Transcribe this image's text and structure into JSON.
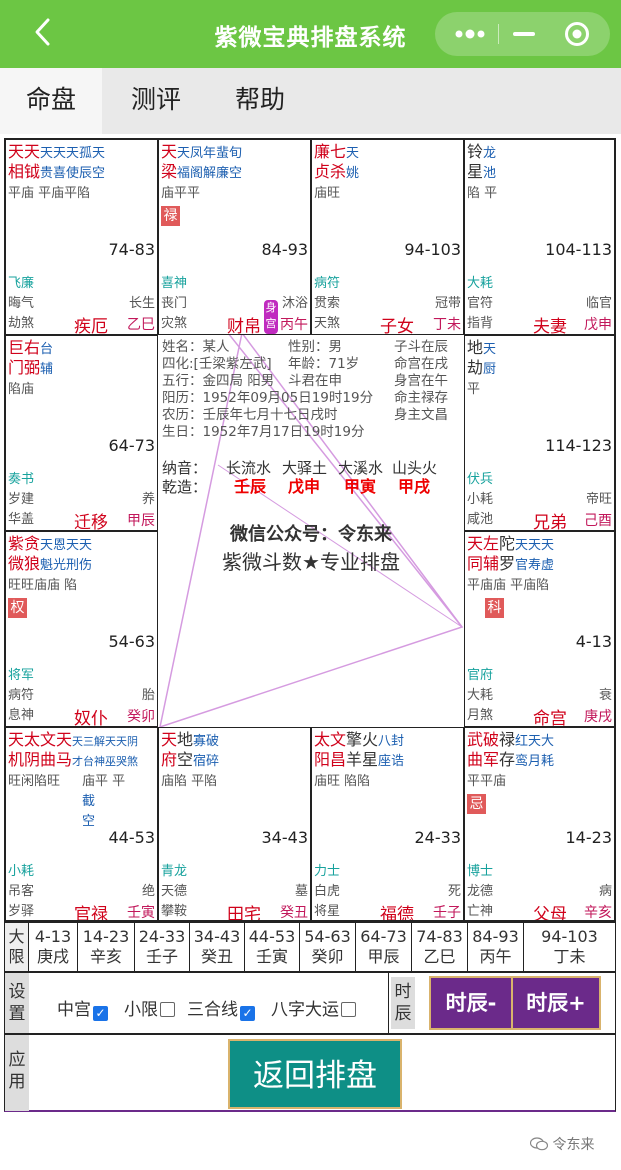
{
  "header": {
    "title": "紫微宝典排盘系统",
    "back_icon": "chevron-left-icon",
    "more_icon": "more-dots-icon",
    "minimize_icon": "minimize-icon",
    "close_icon": "target-icon"
  },
  "tabs": [
    {
      "label": "命盘"
    },
    {
      "label": "测评"
    },
    {
      "label": "帮助"
    }
  ],
  "cells": {
    "si": {
      "l1r": "天天",
      "l1b": "天天天孤天",
      "l2r": "相钺",
      "l2b": "贵喜使辰空",
      "l3": "平庙 平庙平陷",
      "range": "74-83",
      "god": "飞廉",
      "a": "晦气",
      "b": "劫煞",
      "stage": "长生",
      "palace": "疾厄",
      "gz": "乙巳"
    },
    "wu": {
      "l1r": "天",
      "l1b": "天凤年蜚旬",
      "l2r": "梁",
      "l2b": "福阁解廉空",
      "l3": "庙平平",
      "badge": "禄",
      "range": "84-93",
      "god": "喜神",
      "a": "丧门",
      "b": "灾煞",
      "stage": "沐浴",
      "palace": "财帛",
      "gz": "丙午",
      "tag": "身宫"
    },
    "wei": {
      "l1r": "廉七",
      "l1b": "天",
      "l2r": "贞杀",
      "l2b": "姚",
      "l3": "庙旺",
      "range": "94-103",
      "god": "病符",
      "a": "贯索",
      "b": "天煞",
      "stage": "冠带",
      "palace": "子女",
      "gz": "丁未"
    },
    "shen": {
      "l1": "铃",
      "l1b": "龙",
      "l2": "星",
      "l2b": "池",
      "l3": "陷 平",
      "range": "104-113",
      "god": "大耗",
      "a": "官符",
      "b": "指背",
      "stage": "临官",
      "palace": "夫妻",
      "gz": "戊申"
    },
    "chen": {
      "l1r": "巨右",
      "l1b": "台",
      "l2r": "门弼",
      "l2b": "辅",
      "l3": "陷庙",
      "range": "64-73",
      "god": "奏书",
      "a": "岁建",
      "b": "华盖",
      "stage": "养",
      "palace": "迁移",
      "gz": "甲辰"
    },
    "you": {
      "l1": "地",
      "l1b": "天",
      "l2": "劫",
      "l2b": "厨",
      "l3": "平",
      "range": "114-123",
      "god": "伏兵",
      "a": "小耗",
      "b": "咸池",
      "stage": "帝旺",
      "palace": "兄弟",
      "gz": "己酉"
    },
    "mao": {
      "l1r": "紫贪",
      "l1b": "天恩天天",
      "l2r": "微狼",
      "l2b": "魁光刑伤",
      "l3": "旺旺庙庙 陷",
      "badge": "权",
      "range": "54-63",
      "god": "将军",
      "a": "病符",
      "b": "息神",
      "stage": "胎",
      "palace": "奴仆",
      "gz": "癸卯"
    },
    "xu": {
      "l1r": "天左",
      "l1k": "陀",
      "l1b": "天天天",
      "l2r": "同辅",
      "l2k": "罗",
      "l2b": "官寿虚",
      "l3": "平庙庙 平庙陷",
      "badge": "科",
      "range": "4-13",
      "god": "官府",
      "a": "大耗",
      "b": "月煞",
      "stage": "衰",
      "palace": "命宫",
      "gz": "庚戌"
    },
    "yin": {
      "l1r": "天太文天",
      "l1b": "天三解天天阴",
      "l2r": "机阴曲马",
      "l2b": "才台神巫哭煞",
      "l3": "旺闲陷旺",
      "l4": "庙平  平",
      "l5": "截",
      "l6": "空",
      "range": "44-53",
      "god": "小耗",
      "a": "吊客",
      "b": "岁驿",
      "stage": "绝",
      "palace": "官禄",
      "gz": "壬寅"
    },
    "chou": {
      "l1r": "天",
      "l1k": "地",
      "l1b": "寡破",
      "l2r": "府",
      "l2k": "空",
      "l2b": "宿碎",
      "l3": "庙陷 平陷",
      "range": "34-43",
      "god": "青龙",
      "a": "天德",
      "b": "攀鞍",
      "stage": "墓",
      "palace": "田宅",
      "gz": "癸丑"
    },
    "zi": {
      "l1r": "太文",
      "l1k": "擎火",
      "l1b": "八封",
      "l2r": "阳昌",
      "l2k": "羊星",
      "l2b": "座诰",
      "l3": "庙旺 陷陷",
      "range": "24-33",
      "god": "力士",
      "a": "白虎",
      "b": "将星",
      "stage": "死",
      "palace": "福德",
      "gz": "壬子"
    },
    "hai": {
      "l1r": "武破",
      "l1g": "禄",
      "l1k": "红天大",
      "l2r": "曲军",
      "l2k": "存",
      "l2b": "鸾月耗",
      "l3": "平平庙",
      "badge": "忌",
      "range": "14-23",
      "god": "博士",
      "a": "龙德",
      "b": "亡神",
      "stage": "病",
      "palace": "父母",
      "gz": "辛亥"
    }
  },
  "center": {
    "name": "姓名：某人",
    "sex": "性别：男",
    "ming": "子斗在辰",
    "sihua": "四化:[壬梁紫左武]",
    "age": "年龄：71岁",
    "mingzhu": "命宫在戌",
    "wuxing": "五行：金四局 阳男",
    "doujun": "斗君在申",
    "shengong": "身宫在午",
    "solar": "阳历：1952年09月05日19时19分",
    "mingzhu2": "命主禄存",
    "lunar": "农历：壬辰年七月十七日戌时",
    "shenzhu": "身主文昌",
    "birth": "生日：1952年7月17日19时19分",
    "nayin_label": "纳音：",
    "nayin": [
      "长流水",
      "大驿土",
      "大溪水",
      "山头火"
    ],
    "qianzao_label": "乾造：",
    "qianzao": [
      "壬辰",
      "戊申",
      "甲寅",
      "甲戌"
    ],
    "wechat": "微信公众号：令东来",
    "slogan": "紫微斗数★专业排盘"
  },
  "daxian": {
    "label": "大限",
    "items": [
      [
        "4-13",
        "庚戌"
      ],
      [
        "14-23",
        "辛亥"
      ],
      [
        "24-33",
        "壬子"
      ],
      [
        "34-43",
        "癸丑"
      ],
      [
        "44-53",
        "壬寅"
      ],
      [
        "54-63",
        "癸卯"
      ],
      [
        "64-73",
        "甲辰"
      ],
      [
        "74-83",
        "乙巳"
      ],
      [
        "84-93",
        "丙午"
      ],
      [
        "94-103",
        "丁未"
      ]
    ]
  },
  "settings": {
    "label": "设置",
    "zhonggong": "中宫",
    "xiaoxian": "小限",
    "sanhe": "三合线",
    "bazi": "八字大运",
    "zhonggong_checked": true,
    "xiaoxian_checked": false,
    "sanhe_checked": true,
    "bazi_checked": false,
    "shichen_label": "时辰",
    "prev": "时辰-",
    "next": "时辰+"
  },
  "apply": {
    "label": "应用",
    "return": "返回排盘"
  },
  "watermark": "令东来"
}
